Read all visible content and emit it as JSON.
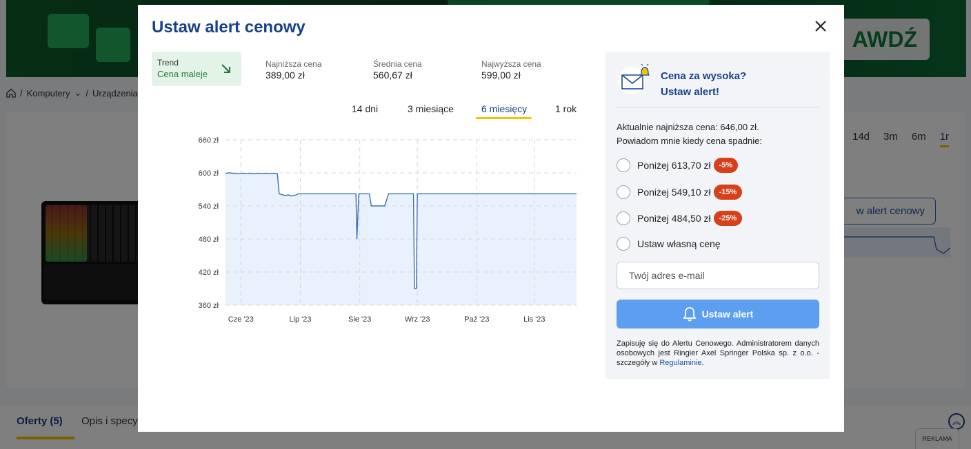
{
  "background": {
    "banner_button": "AWDŹ",
    "breadcrumb": [
      "Komputery",
      "Urządzenia w"
    ],
    "periods": [
      "14d",
      "3m",
      "6m",
      "1r"
    ],
    "active_period": "1r",
    "alert_button_partial": "w alert cenowy",
    "tabs": {
      "active": "Oferty (5)",
      "other": "Opis i specyf"
    },
    "ad_label": "REKLAMA"
  },
  "modal": {
    "title": "Ustaw alert cenowy",
    "trend": {
      "label": "Trend",
      "value": "Cena maleje",
      "icon": "arrow-down-right-icon",
      "color": "#1c7a3a"
    },
    "stats": [
      {
        "label": "Najniższa cena",
        "value": "389,00 zł"
      },
      {
        "label": "Średnia cena",
        "value": "560,67 zł"
      },
      {
        "label": "Najwyższa cena",
        "value": "599,00 zł"
      }
    ],
    "periods": [
      "14 dni",
      "3 miesiące",
      "6 miesięcy",
      "1 rok"
    ],
    "active_period": "6 miesięcy"
  },
  "chart_data": {
    "type": "area",
    "title": "",
    "xlabel": "",
    "ylabel": "",
    "y_ticks": [
      "660 zł",
      "600 zł",
      "540 zł",
      "480 zł",
      "420 zł",
      "360 zł"
    ],
    "ylim": [
      360,
      660
    ],
    "x_ticks": [
      "Cze '23",
      "Lip '23",
      "Sie '23",
      "Wrz '23",
      "Paź '23",
      "Lis '23"
    ],
    "x_tick_days": [
      8,
      39,
      70,
      100,
      131,
      161
    ],
    "xlim": [
      0,
      183
    ],
    "grid": true,
    "line_color": "#3a6fb8",
    "fill_color": "#e8f1fc",
    "series": [
      {
        "values": [
          [
            0,
            599
          ],
          [
            2,
            600
          ],
          [
            5,
            599
          ],
          [
            27,
            599
          ],
          [
            28,
            562
          ],
          [
            31,
            559
          ],
          [
            33,
            560
          ],
          [
            34,
            558
          ],
          [
            37,
            560
          ],
          [
            38,
            562
          ],
          [
            68,
            562
          ],
          [
            68.5,
            480
          ],
          [
            69.5,
            562
          ],
          [
            75,
            562
          ],
          [
            76,
            540
          ],
          [
            83,
            540
          ],
          [
            85,
            562
          ],
          [
            98,
            562
          ],
          [
            98.5,
            390
          ],
          [
            99.5,
            390
          ],
          [
            100,
            562
          ],
          [
            183,
            562
          ]
        ]
      }
    ]
  },
  "panel": {
    "title_line1": "Cena za wysoka?",
    "title_line2": "Ustaw alert!",
    "info_line1": "Aktualnie najniższa cena: 646,00 zł.",
    "info_line2": "Powiadom mnie kiedy cena spadnie:",
    "options": [
      {
        "label": "Poniżej 613,70 zł",
        "badge": "-5%"
      },
      {
        "label": "Poniżej 549,10 zł",
        "badge": "-15%"
      },
      {
        "label": "Poniżej 484,50 zł",
        "badge": "-25%"
      },
      {
        "label": "Ustaw własną cenę",
        "badge": null
      }
    ],
    "email_placeholder": "Twój adres e-mail",
    "submit_label": "Ustaw alert",
    "legal_text": "Zapisuję się do Alertu Cenowego. Administratorem danych osobowych jest Ringier Axel Springer Polska sp. z o.o. - szczegóły w ",
    "legal_link": "Regulaminie",
    "legal_end": ".",
    "badge_color": "#d8401c",
    "accent": "#17408b"
  }
}
